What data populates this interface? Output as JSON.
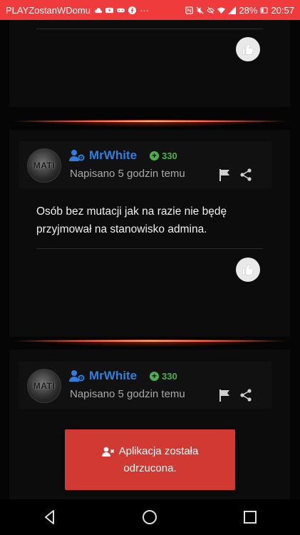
{
  "status_bar": {
    "carrier": "PLAYZostanWDomu",
    "battery": "28%",
    "time": "20:57",
    "icons": [
      "cloud-icon",
      "youtube-icon",
      "gamepad-icon",
      "facebook-icon",
      "more-dots-icon",
      "nfc-icon",
      "mute-icon",
      "eye-off-icon",
      "wifi-icon",
      "signal-icon",
      "battery-icon"
    ]
  },
  "posts": [
    {
      "author": "MrWhite",
      "avatar_text": "MATI",
      "reputation": "330",
      "posted": "Napisano 5 godzin temu",
      "text_line1": "Osób bez mutacji jak na razie nie będę",
      "text_line2": "przyjmował na stanowisko admina."
    },
    {
      "author": "MrWhite",
      "avatar_text": "MATI",
      "reputation": "330",
      "posted": "Napisano 5 godzin temu"
    }
  ],
  "toast": {
    "line1": "Aplikacja została",
    "line2": "odrzucona."
  },
  "colors": {
    "status_bar": "#ef3b3b",
    "username": "#2f7fe0",
    "reputation": "#49b24a",
    "toast": "#d13a32"
  }
}
